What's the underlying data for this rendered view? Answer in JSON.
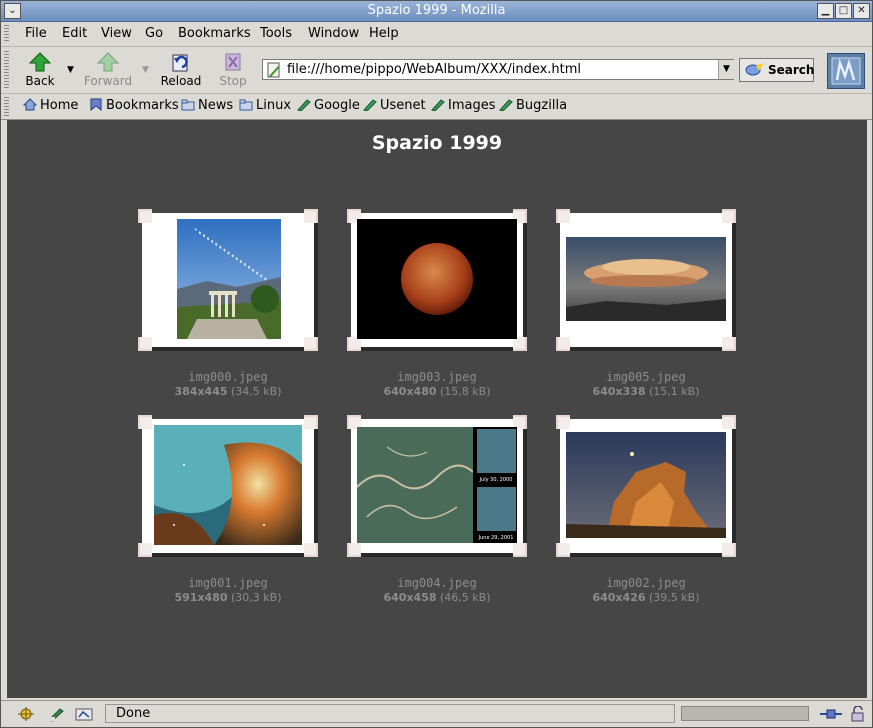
{
  "window": {
    "title": "Spazio 1999 - Mozilla"
  },
  "menu": [
    "File",
    "Edit",
    "View",
    "Go",
    "Bookmarks",
    "Tools",
    "Window",
    "Help"
  ],
  "nav": {
    "back": "Back",
    "forward": "Forward",
    "reload": "Reload",
    "stop": "Stop"
  },
  "url": "file:///home/pippo/WebAlbum/XXX/index.html",
  "search_label": "Search",
  "personal": [
    "Home",
    "Bookmarks",
    "News",
    "Linux",
    "Google",
    "Usenet",
    "Images",
    "Bugzilla"
  ],
  "page": {
    "title": "Spazio 1999"
  },
  "images": [
    {
      "file": "img000.jpeg",
      "dims": "384x445",
      "size": "(34,5 kB)"
    },
    {
      "file": "img003.jpeg",
      "dims": "640x480",
      "size": "(15,8 kB)"
    },
    {
      "file": "img005.jpeg",
      "dims": "640x338",
      "size": "(15,1 kB)"
    },
    {
      "file": "img001.jpeg",
      "dims": "591x480",
      "size": "(30,3 kB)"
    },
    {
      "file": "img004.jpeg",
      "dims": "640x458",
      "size": "(46,5 kB)"
    },
    {
      "file": "img002.jpeg",
      "dims": "640x426",
      "size": "(39,5 kB)"
    }
  ],
  "photo_labels": {
    "inset_top": "July 30, 2000",
    "inset_bottom": "June 29, 2001"
  },
  "status": "Done",
  "colors": {
    "content_bg": "#464646",
    "title_text": "#ffffff",
    "caption_text": "#8c8c8c"
  }
}
